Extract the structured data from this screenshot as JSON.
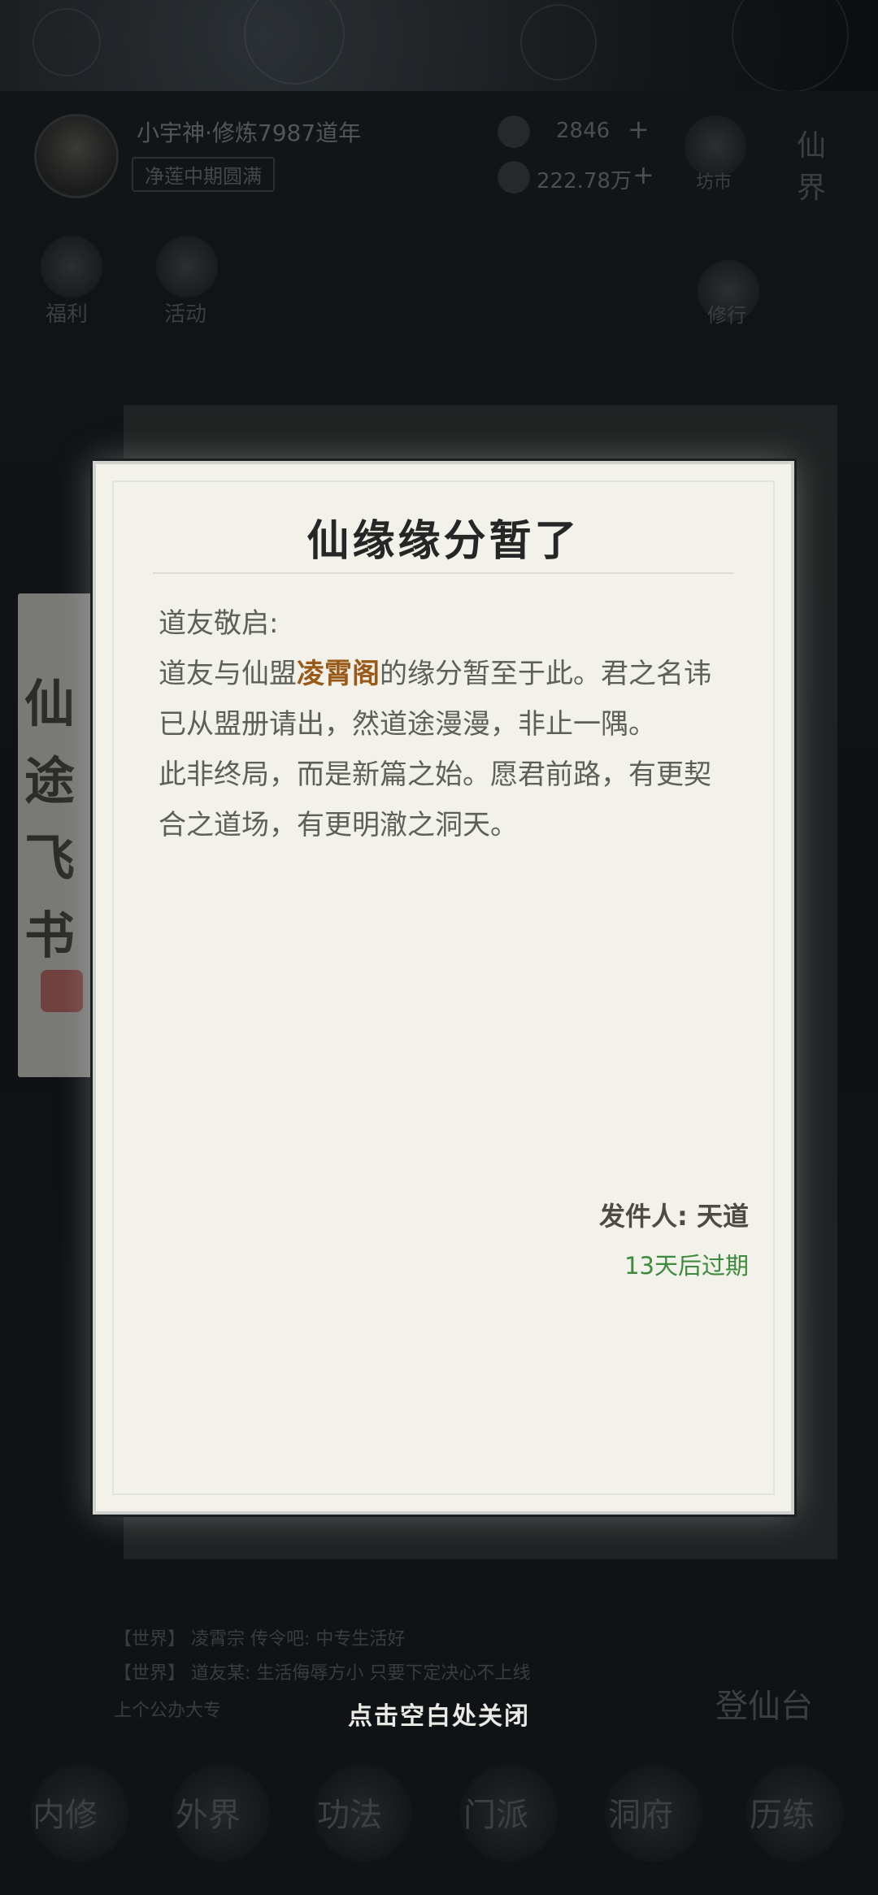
{
  "background": {
    "player_name": "小宇神·修炼7987道年",
    "player_rank": "净莲中期圆满",
    "currency_1": "2846",
    "currency_2": "222.78万",
    "icons": [
      {
        "name": "market-icon",
        "label": "坊市"
      },
      {
        "name": "fairy-world-icon",
        "label": "仙界"
      },
      {
        "name": "welfare-icon",
        "label": "福利"
      },
      {
        "name": "event-icon",
        "label": "活动"
      },
      {
        "name": "cultivate-icon",
        "label": "修行"
      }
    ],
    "side_book_chars": [
      "仙",
      "途",
      "飞",
      "书"
    ],
    "chat_lines": [
      "【世界】 凌霄宗 传令吧: 中专生活好",
      "【世界】 道友某: 生活侮辱方小 只要下定决心不上线",
      "上个公办大专"
    ],
    "side_right_label": "登仙台",
    "bottom_nav": [
      "内修",
      "外界",
      "功法",
      "门派",
      "洞府",
      "历练"
    ]
  },
  "letter": {
    "title": "仙缘缘分暂了",
    "greeting": "道友敬启:",
    "para1_prefix": "道友与仙盟",
    "para1_highlight": "凌霄阁",
    "para1_suffix": "的缘分暂至于此。君之名讳已从盟册请出，然道途漫漫，非止一隅。",
    "para2": "此非终局，而是新篇之始。愿君前路，有更契合之道场，有更明澈之洞天。",
    "sender": "发件人: 天道",
    "expire": "13天后过期"
  },
  "close_hint": "点击空白处关闭",
  "colors": {
    "paper": "#f2f1ea",
    "highlight": "#9a5a17",
    "expire_green": "#3d8a3c",
    "overlay": "#0e1012"
  }
}
